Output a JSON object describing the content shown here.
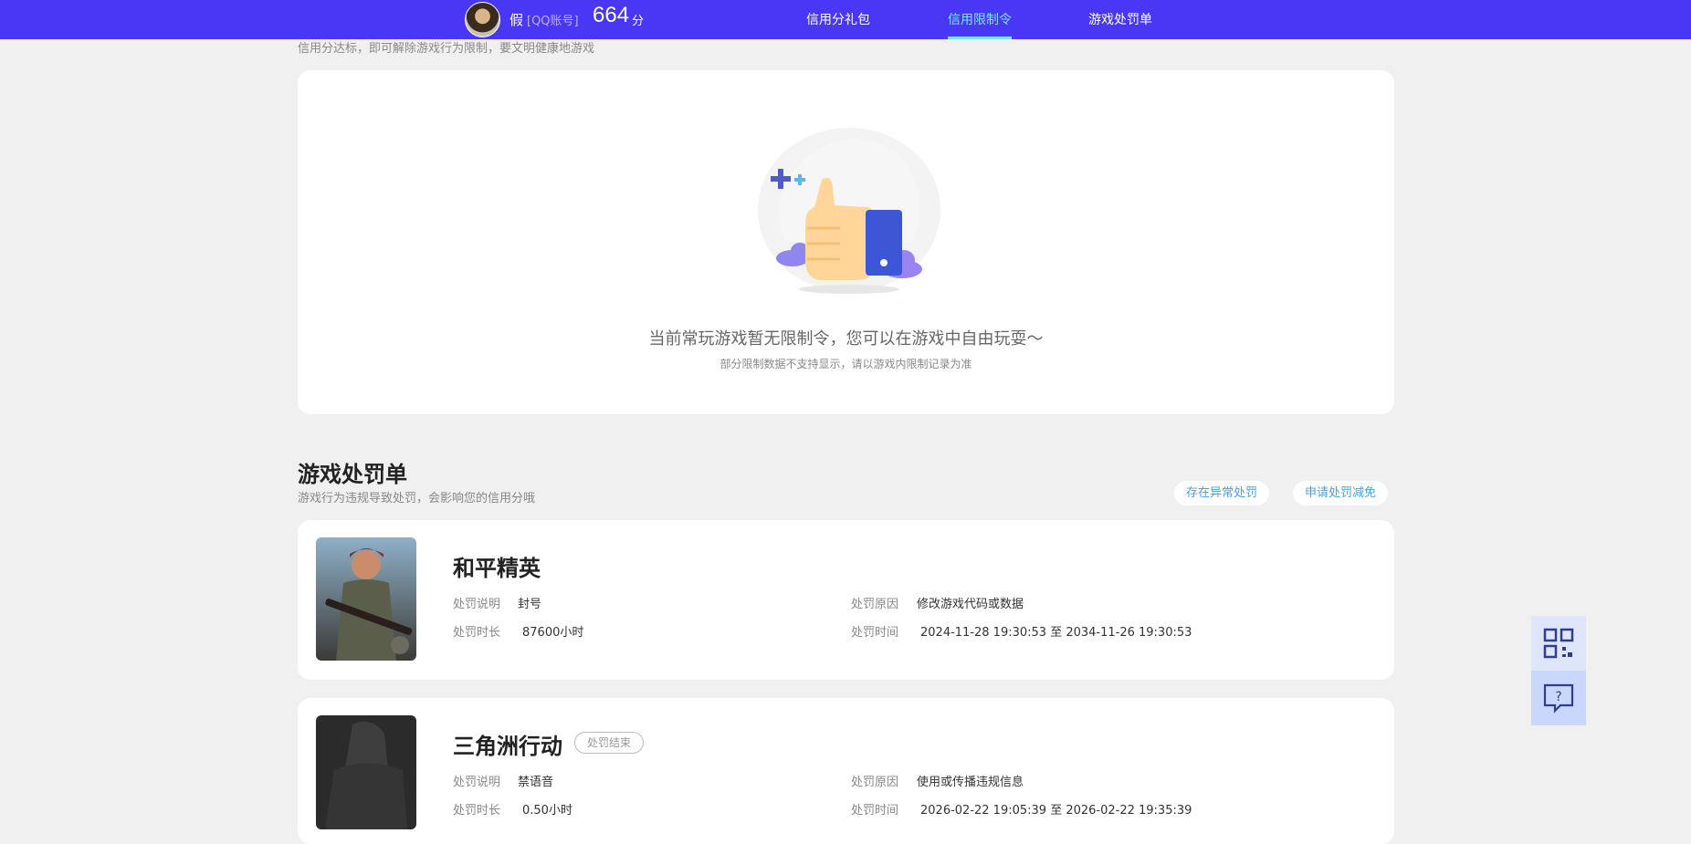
{
  "header": {
    "user_name": "假",
    "account_type": "[QQ账号]",
    "score": "664",
    "score_unit": "分",
    "nav": [
      {
        "label": "信用分礼包",
        "active": false
      },
      {
        "label": "信用限制令",
        "active": true
      },
      {
        "label": "游戏处罚单",
        "active": false
      }
    ],
    "accent_color": "#4a36f5",
    "active_color": "#7fe3ff"
  },
  "restriction": {
    "subtitle": "信用分达标，即可解除游戏行为限制，要文明健康地游戏",
    "empty_title": "当前常玩游戏暂无限制令，您可以在游戏中自由玩耍～",
    "empty_note": "部分限制数据不支持显示，请以游戏内限制记录为准",
    "illustration_icon": "thumbs-up-illustration"
  },
  "penalty_section": {
    "title": "游戏处罚单",
    "description": "游戏行为违规导致处罚，会影响您的信用分哦",
    "actions": [
      "存在异常处罚",
      "申请处罚减免"
    ],
    "labels": {
      "desc": "处罚说明",
      "reason": "处罚原因",
      "duration": "处罚时长",
      "time": "处罚时间"
    },
    "items": [
      {
        "game": "和平精英",
        "badge": "",
        "desc": "封号",
        "reason": "修改游戏代码或数据",
        "duration": "87600小时",
        "time": "2024-11-28 19:30:53 至 2034-11-26 19:30:53"
      },
      {
        "game": "三角洲行动",
        "badge": "处罚结束",
        "desc": "禁语音",
        "reason": "使用或传播违规信息",
        "duration": "0.50小时",
        "time": "2026-02-22 19:05:39 至 2026-02-22 19:35:39"
      }
    ]
  },
  "side_buttons": [
    {
      "icon": "qr-code-icon"
    },
    {
      "icon": "help-chat-icon"
    }
  ]
}
